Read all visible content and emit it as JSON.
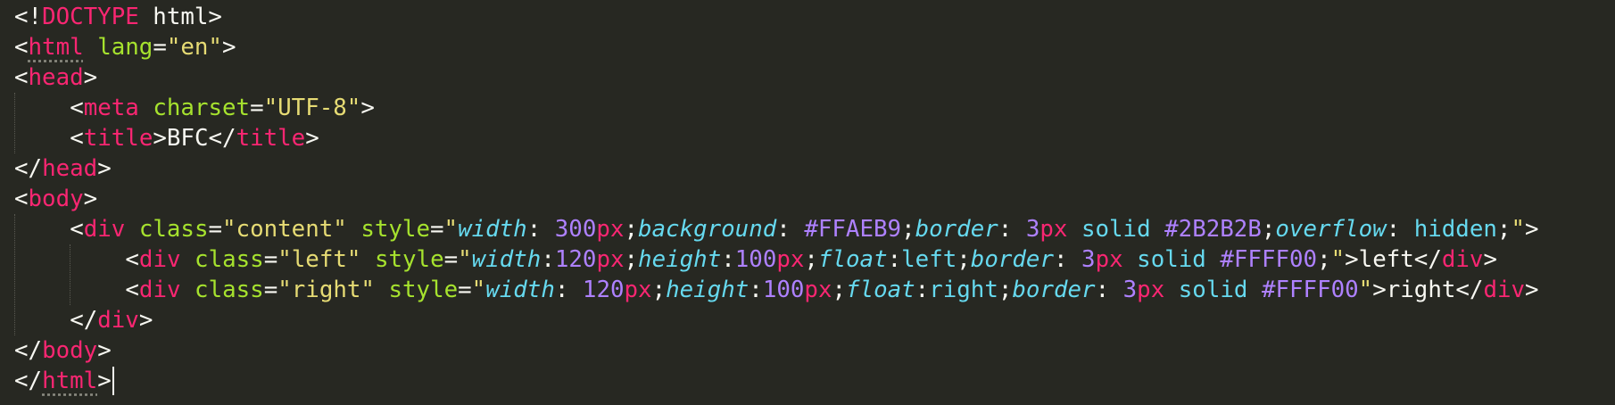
{
  "editor": {
    "theme_colors": {
      "background": "#272822",
      "punctuation": "#F8F8F2",
      "tag": "#F92672",
      "attribute": "#A6E22E",
      "string": "#E6DB74",
      "css_property": "#66D9EF",
      "number": "#AE81FF"
    },
    "lines": [
      {
        "indent": 0,
        "tokens": [
          [
            "p",
            "<!"
          ],
          [
            "t",
            "DOCTYPE"
          ],
          [
            "p",
            " html>"
          ]
        ]
      },
      {
        "indent": 0,
        "tokens": [
          [
            "p",
            "<"
          ],
          [
            "t",
            "html"
          ],
          [
            "p",
            " "
          ],
          [
            "a",
            "lang"
          ],
          [
            "p",
            "="
          ],
          [
            "s",
            "\"en\""
          ],
          [
            "p",
            ">"
          ]
        ]
      },
      {
        "indent": 0,
        "tokens": [
          [
            "p",
            "<"
          ],
          [
            "t",
            "head"
          ],
          [
            "p",
            ">"
          ]
        ]
      },
      {
        "indent": 1,
        "tokens": [
          [
            "p",
            "<"
          ],
          [
            "t",
            "meta"
          ],
          [
            "p",
            " "
          ],
          [
            "a",
            "charset"
          ],
          [
            "p",
            "="
          ],
          [
            "s",
            "\"UTF-8\""
          ],
          [
            "p",
            ">"
          ]
        ]
      },
      {
        "indent": 1,
        "tokens": [
          [
            "p",
            "<"
          ],
          [
            "t",
            "title"
          ],
          [
            "p",
            ">BFC</"
          ],
          [
            "t",
            "title"
          ],
          [
            "p",
            ">"
          ]
        ]
      },
      {
        "indent": 0,
        "tokens": [
          [
            "p",
            "</"
          ],
          [
            "t",
            "head"
          ],
          [
            "p",
            ">"
          ]
        ]
      },
      {
        "indent": 0,
        "tokens": [
          [
            "p",
            "<"
          ],
          [
            "t",
            "body"
          ],
          [
            "p",
            ">"
          ]
        ]
      },
      {
        "indent": 1,
        "tokens": [
          [
            "p",
            "<"
          ],
          [
            "t",
            "div"
          ],
          [
            "p",
            " "
          ],
          [
            "a",
            "class"
          ],
          [
            "p",
            "="
          ],
          [
            "s",
            "\"content\""
          ],
          [
            "p",
            " "
          ],
          [
            "a",
            "style"
          ],
          [
            "p",
            "="
          ],
          [
            "s",
            "\""
          ],
          [
            "cp",
            "width"
          ],
          [
            "p",
            ": "
          ],
          [
            "n",
            "300"
          ],
          [
            "u",
            "px"
          ],
          [
            "p",
            ";"
          ],
          [
            "cp",
            "background"
          ],
          [
            "p",
            ": "
          ],
          [
            "n",
            "#FFAEB9"
          ],
          [
            "p",
            ";"
          ],
          [
            "cp",
            "border"
          ],
          [
            "p",
            ": "
          ],
          [
            "n",
            "3"
          ],
          [
            "u",
            "px"
          ],
          [
            "p",
            " "
          ],
          [
            "v",
            "solid"
          ],
          [
            "p",
            " "
          ],
          [
            "n",
            "#2B2B2B"
          ],
          [
            "p",
            ";"
          ],
          [
            "cp",
            "overflow"
          ],
          [
            "p",
            ": "
          ],
          [
            "v",
            "hidden"
          ],
          [
            "p",
            ";"
          ],
          [
            "s",
            "\""
          ],
          [
            "p",
            ">"
          ]
        ]
      },
      {
        "indent": 2,
        "tokens": [
          [
            "p",
            "<"
          ],
          [
            "t",
            "div"
          ],
          [
            "p",
            " "
          ],
          [
            "a",
            "class"
          ],
          [
            "p",
            "="
          ],
          [
            "s",
            "\"left\""
          ],
          [
            "p",
            " "
          ],
          [
            "a",
            "style"
          ],
          [
            "p",
            "="
          ],
          [
            "s",
            "\""
          ],
          [
            "cp",
            "width"
          ],
          [
            "p",
            ":"
          ],
          [
            "n",
            "120"
          ],
          [
            "u",
            "px"
          ],
          [
            "p",
            ";"
          ],
          [
            "cp",
            "height"
          ],
          [
            "p",
            ":"
          ],
          [
            "n",
            "100"
          ],
          [
            "u",
            "px"
          ],
          [
            "p",
            ";"
          ],
          [
            "cp",
            "float"
          ],
          [
            "p",
            ":"
          ],
          [
            "v",
            "left"
          ],
          [
            "p",
            ";"
          ],
          [
            "cp",
            "border"
          ],
          [
            "p",
            ": "
          ],
          [
            "n",
            "3"
          ],
          [
            "u",
            "px"
          ],
          [
            "p",
            " "
          ],
          [
            "v",
            "solid"
          ],
          [
            "p",
            " "
          ],
          [
            "n",
            "#FFFF00"
          ],
          [
            "p",
            ";"
          ],
          [
            "s",
            "\""
          ],
          [
            "p",
            ">left</"
          ],
          [
            "t",
            "div"
          ],
          [
            "p",
            ">"
          ]
        ]
      },
      {
        "indent": 2,
        "tokens": [
          [
            "p",
            "<"
          ],
          [
            "t",
            "div"
          ],
          [
            "p",
            " "
          ],
          [
            "a",
            "class"
          ],
          [
            "p",
            "="
          ],
          [
            "s",
            "\"right\""
          ],
          [
            "p",
            " "
          ],
          [
            "a",
            "style"
          ],
          [
            "p",
            "="
          ],
          [
            "s",
            "\""
          ],
          [
            "cp",
            "width"
          ],
          [
            "p",
            ": "
          ],
          [
            "n",
            "120"
          ],
          [
            "u",
            "px"
          ],
          [
            "p",
            ";"
          ],
          [
            "cp",
            "height"
          ],
          [
            "p",
            ":"
          ],
          [
            "n",
            "100"
          ],
          [
            "u",
            "px"
          ],
          [
            "p",
            ";"
          ],
          [
            "cp",
            "float"
          ],
          [
            "p",
            ":"
          ],
          [
            "v",
            "right"
          ],
          [
            "p",
            ";"
          ],
          [
            "cp",
            "border"
          ],
          [
            "p",
            ": "
          ],
          [
            "n",
            "3"
          ],
          [
            "u",
            "px"
          ],
          [
            "p",
            " "
          ],
          [
            "v",
            "solid"
          ],
          [
            "p",
            " "
          ],
          [
            "n",
            "#FFFF00"
          ],
          [
            "s",
            "\""
          ],
          [
            "p",
            ">right</"
          ],
          [
            "t",
            "div"
          ],
          [
            "p",
            ">"
          ]
        ]
      },
      {
        "indent": 1,
        "tokens": [
          [
            "p",
            "</"
          ],
          [
            "t",
            "div"
          ],
          [
            "p",
            ">"
          ]
        ]
      },
      {
        "indent": 0,
        "tokens": [
          [
            "p",
            "</"
          ],
          [
            "t",
            "body"
          ],
          [
            "p",
            ">"
          ]
        ]
      },
      {
        "indent": 0,
        "tokens": [
          [
            "p",
            "</"
          ],
          [
            "t",
            "html"
          ],
          [
            "p",
            ">"
          ]
        ]
      }
    ]
  }
}
